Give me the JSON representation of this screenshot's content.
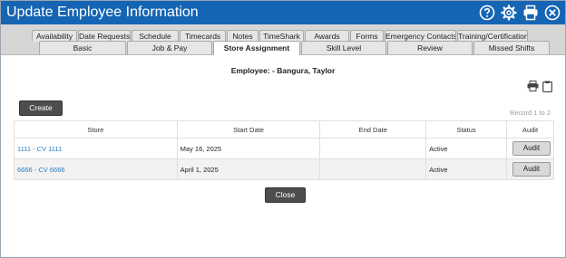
{
  "window": {
    "title": "Update Employee Information"
  },
  "title_icons": [
    "help-icon",
    "gear-icon",
    "print-icon",
    "close-icon"
  ],
  "tabs_row1": [
    "Availability",
    "Date Requests",
    "Schedule",
    "Timecards",
    "Notes",
    "TimeShark",
    "Awards",
    "Forms",
    "Emergency Contacts",
    "Training/Certifications"
  ],
  "tabs_row2": [
    "Basic",
    "Job & Pay",
    "Store Assignment",
    "Skill Level",
    "Review",
    "Missed Shifts"
  ],
  "active_tab": "Store Assignment",
  "employee": {
    "line": "Employee: - Bangura, Taylor"
  },
  "create_label": "Create",
  "record_text": "Record 1 to 2",
  "table": {
    "headers": [
      "Store",
      "Start Date",
      "End Date",
      "Status",
      "Audit"
    ],
    "rows": [
      {
        "store": "1111 - CV 1111",
        "start": "May 16, 2025",
        "end": "",
        "status": "Active",
        "audit": "Audit"
      },
      {
        "store": "6666 - CV 6666",
        "start": "April 1, 2025",
        "end": "",
        "status": "Active",
        "audit": "Audit"
      }
    ]
  },
  "close_label": "Close",
  "colors": {
    "titlebar": "#1565b4",
    "link": "#2a7bbd",
    "dark_button": "#4d4d4d"
  }
}
